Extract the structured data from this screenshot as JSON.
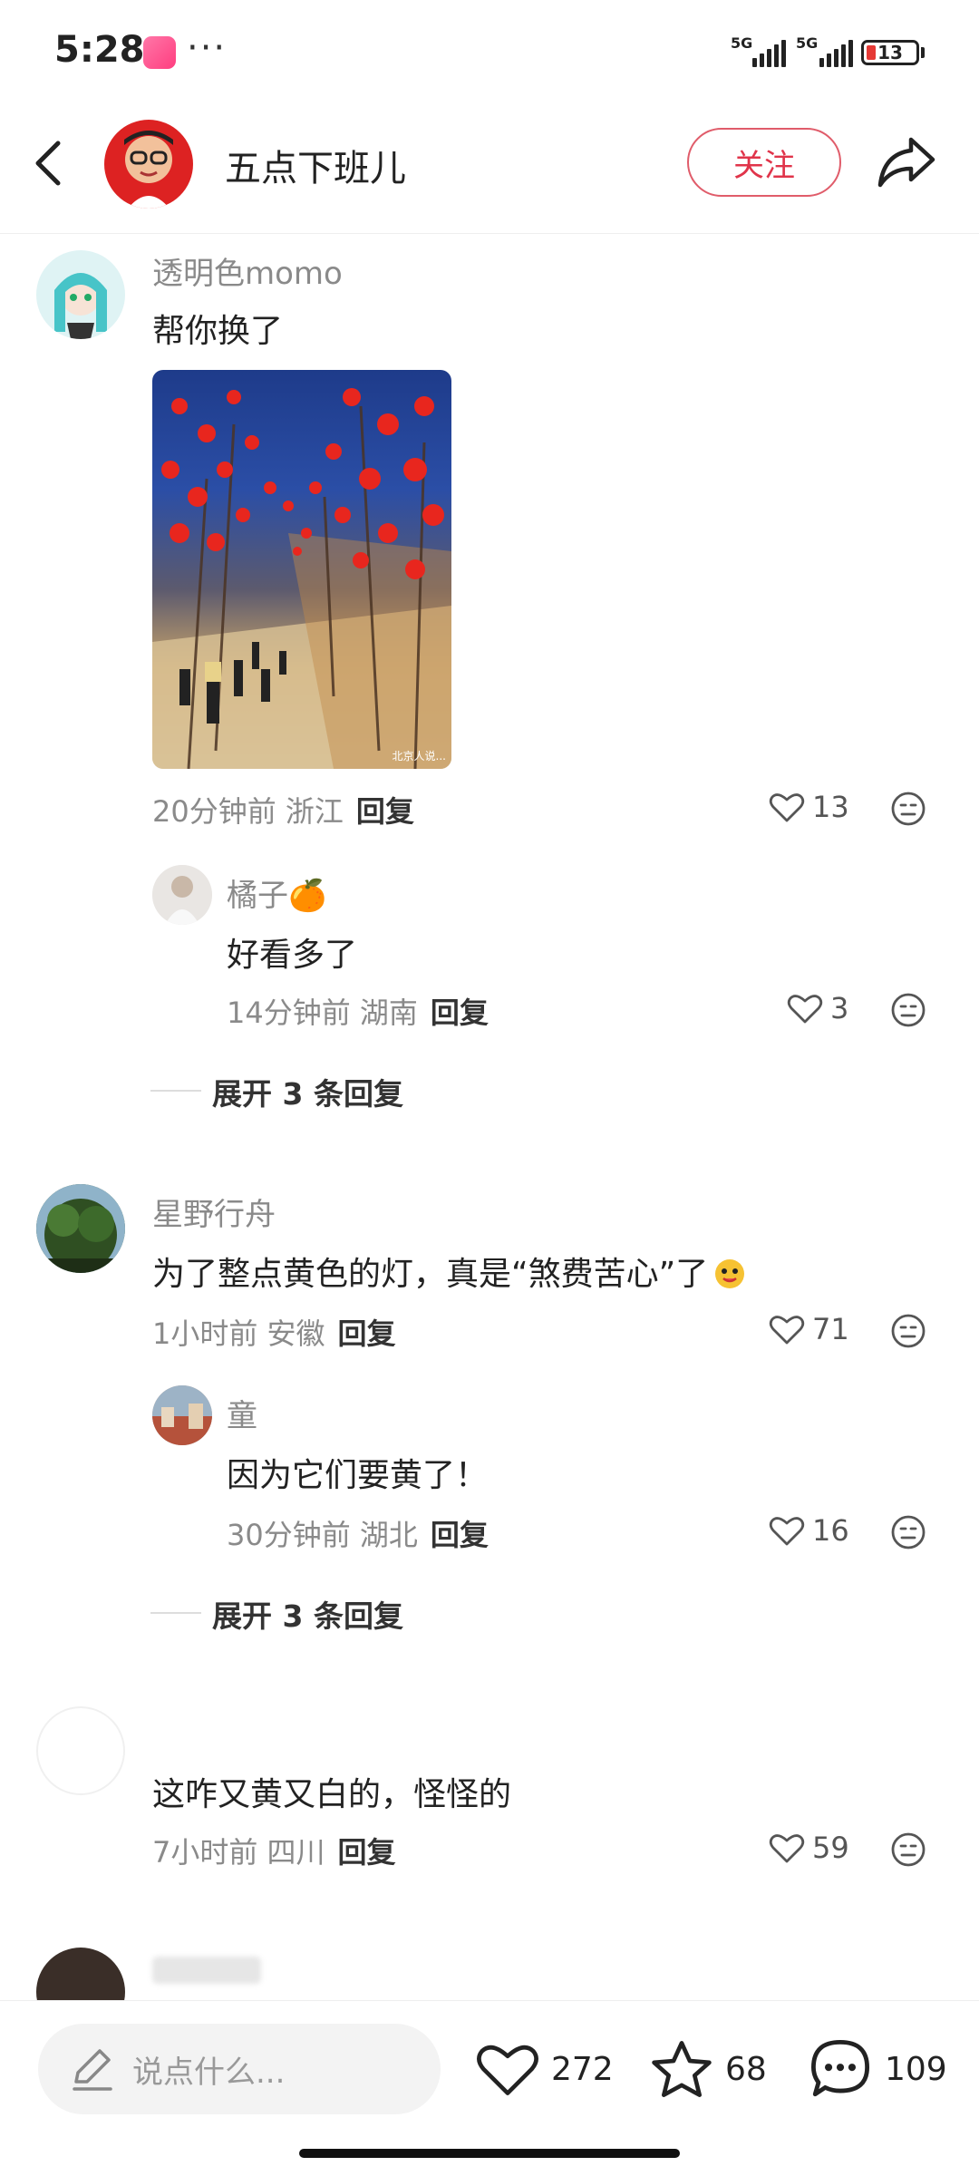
{
  "status_bar": {
    "time": "5:28",
    "dots": "···",
    "signal1": "5G",
    "signal2": "5G",
    "battery": "13"
  },
  "header": {
    "author_name": "五点下班儿",
    "follow_label": "关注"
  },
  "comments": [
    {
      "name": "透明色momo",
      "text": "帮你换了",
      "time_loc": "20分钟前 浙江",
      "reply_label": "回复",
      "likes": "13",
      "image_caption": "北京人说..."
    },
    {
      "name": "橘子🍊",
      "text": "好看多了",
      "time_loc": "14分钟前 湖南",
      "reply_label": "回复",
      "likes": "3"
    },
    {
      "expand_label": "展开 3 条回复"
    },
    {
      "name": "星野行舟",
      "text": "为了整点黄色的灯，真是“煞费苦心”了",
      "time_loc": "1小时前 安徽",
      "reply_label": "回复",
      "likes": "71"
    },
    {
      "name": "童",
      "text": "因为它们要黄了！",
      "time_loc": "30分钟前 湖北",
      "reply_label": "回复",
      "likes": "16"
    },
    {
      "expand_label": "展开 3 条回复"
    },
    {
      "name": "",
      "text": "这咋又黄又白的，怪怪的",
      "time_loc": "7小时前 四川",
      "reply_label": "回复",
      "likes": "59"
    }
  ],
  "bottom_bar": {
    "input_placeholder": "说点什么...",
    "like_count": "272",
    "star_count": "68",
    "comment_count": "109"
  },
  "colors": {
    "accent": "#e0344a",
    "muted_text": "#8a8a8a",
    "background": "#ffffff"
  }
}
